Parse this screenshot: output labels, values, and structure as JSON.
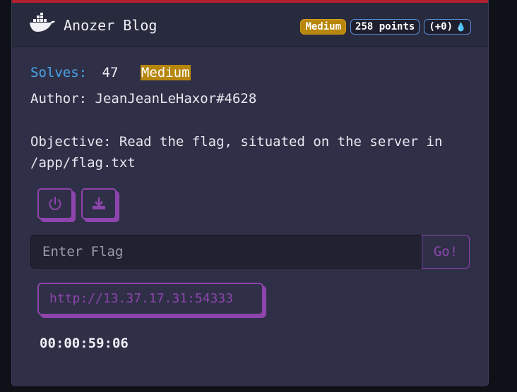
{
  "header": {
    "title": "Anozer Blog",
    "difficulty_badge": "Medium",
    "points_badge": "258 points",
    "bonus_badge": "(+0)"
  },
  "meta": {
    "solves_label": "Solves:",
    "solves_value": "47",
    "difficulty": "Medium",
    "author": "Author: JeanJeanLeHaxor#4628"
  },
  "objective": "Objective: Read the flag, situated on the server in /app/flag.txt",
  "flag": {
    "placeholder": "Enter Flag",
    "submit_label": "Go!"
  },
  "instance": {
    "url": "http://13.37.17.31:54333",
    "timer": "00:00:59:06"
  },
  "icons": {
    "logo": "docker-whale-icon",
    "power": "power-icon",
    "download": "download-icon",
    "first_blood": "blood-drop-icon"
  },
  "colors": {
    "accent": "#8e44ad",
    "difficulty": "#b8860b",
    "solves_label": "#4aa3e8",
    "top_bar": "#b3202e",
    "blood": "#e01e35"
  }
}
